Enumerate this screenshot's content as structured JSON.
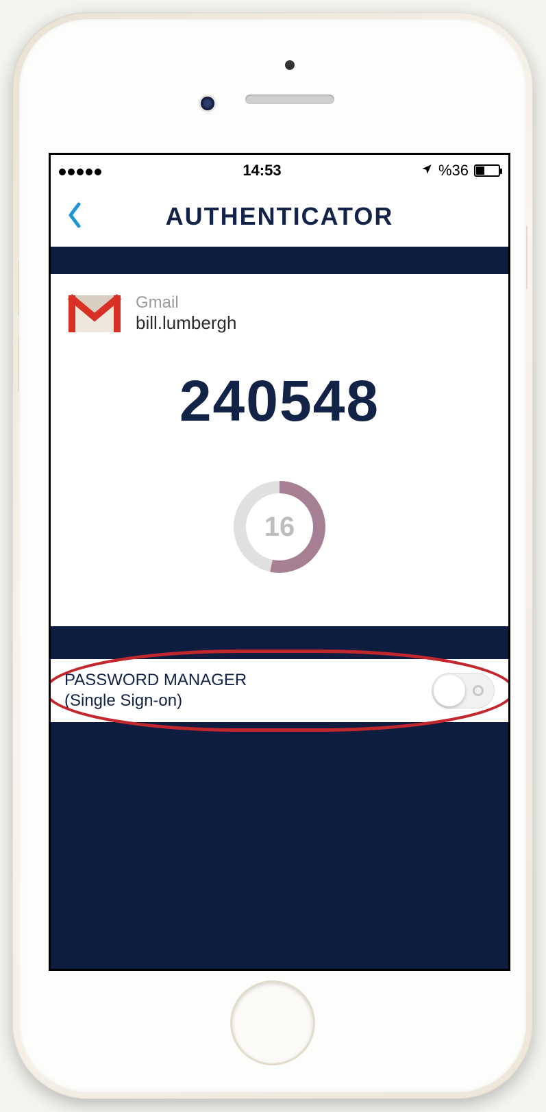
{
  "status": {
    "time": "14:53",
    "battery_text": "%36",
    "battery_level": 36
  },
  "nav": {
    "title": "AUTHENTICATOR"
  },
  "account": {
    "service": "Gmail",
    "username": "bill.lumbergh",
    "icon": "gmail-icon"
  },
  "otp": {
    "code": "240548",
    "seconds_remaining": "16",
    "timer_max": 30
  },
  "password_manager": {
    "label_line1": "PASSWORD MANAGER",
    "label_line2": "(Single Sign-on)",
    "toggle_on": false
  },
  "colors": {
    "brand_dark": "#132347",
    "bg_dark": "#0e1d3f",
    "ring_progress": "#a77f92",
    "ring_track": "#e0e0e0",
    "annotation": "#c1272d"
  }
}
